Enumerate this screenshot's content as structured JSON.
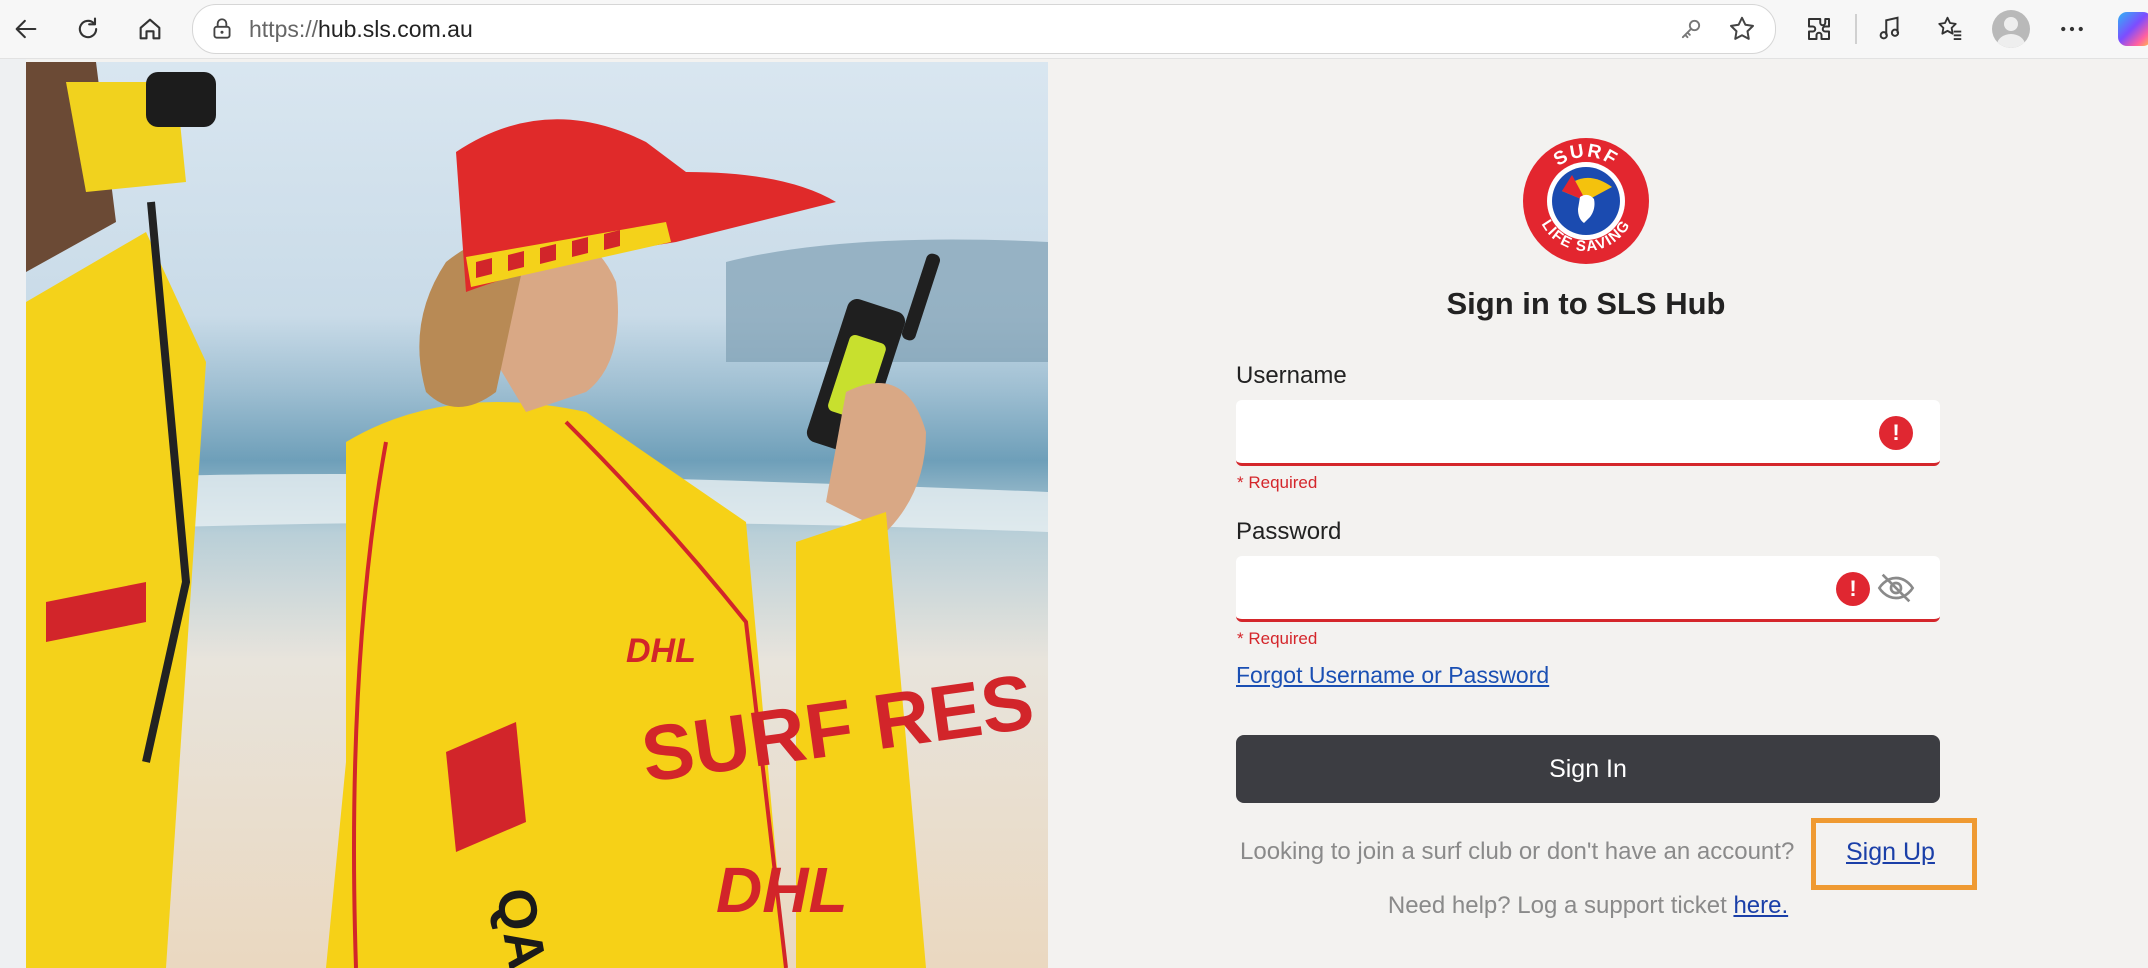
{
  "browser": {
    "url_scheme": "https://",
    "url_host": "hub.sls.com.au",
    "icons": [
      "back-icon",
      "refresh-icon",
      "home-icon",
      "site-info-icon",
      "key-icon",
      "favorite-star-icon",
      "extensions-icon",
      "media-icon",
      "favorites-icon",
      "profile-avatar",
      "more-icon",
      "copilot-icon"
    ]
  },
  "hero": {
    "image": "lifeguards-on-beach-photo"
  },
  "logo": {
    "name": "surf-life-saving-logo",
    "text_top": "SURF",
    "text_bottom": "LIFE SAVING"
  },
  "login": {
    "title": "Sign in to SLS Hub",
    "username_label": "Username",
    "username_value": "",
    "username_error": "* Required",
    "password_label": "Password",
    "password_value": "",
    "password_error": "* Required",
    "forgot_link": "Forgot Username or Password",
    "signin_button": "Sign In",
    "join_text": "Looking to join a surf club or don't have an account?",
    "signup_link": "Sign Up",
    "help_text": "Need help? Log a support ticket",
    "help_link": "here."
  },
  "colors": {
    "error": "#d4262b",
    "button": "#3c3d42",
    "link": "#1a3fa8",
    "highlight": "#ef9a32"
  }
}
